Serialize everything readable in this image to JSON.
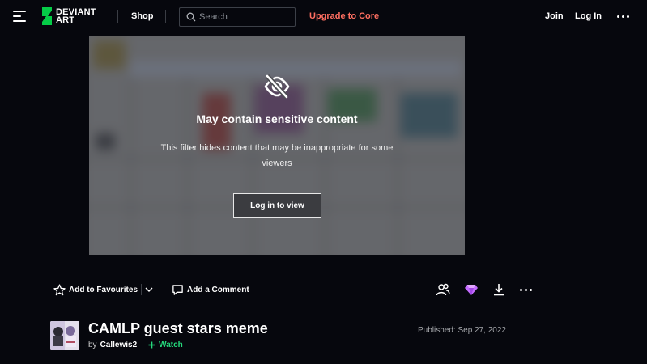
{
  "header": {
    "logo_line1": "DEVIANT",
    "logo_line2": "ART",
    "shop_label": "Shop",
    "search_placeholder": "Search",
    "upgrade_label": "Upgrade to Core",
    "join_label": "Join",
    "login_label": "Log In",
    "brand_color": "#05cc47",
    "upgrade_color": "#ff6f61"
  },
  "preview": {
    "sensitive_title": "May contain sensitive content",
    "sensitive_description": "This filter hides content that may be inappropriate for some viewers",
    "login_button_label": "Log in to view",
    "icon": "eye-slash-icon"
  },
  "actions": {
    "favourite_label": "Add to Favourites",
    "comment_label": "Add a Comment",
    "icons": [
      "star-icon",
      "chevron-down-icon",
      "comment-icon",
      "people-icon",
      "gem-icon",
      "download-icon",
      "more-icon"
    ]
  },
  "deviation": {
    "title": "CAMLP guest stars meme",
    "by_label": "by",
    "author": "Callewis2",
    "watch_label": "Watch",
    "published": "Published: Sep 27, 2022",
    "watch_color": "#25d97c"
  }
}
